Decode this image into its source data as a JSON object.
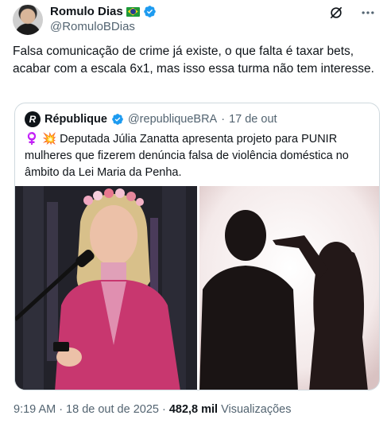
{
  "author": {
    "display_name": "Romulo Dias",
    "handle": "@RomuloBDias",
    "flag_icon": "brazil-flag-icon",
    "verified_icon": "verified-badge-icon"
  },
  "header_actions": {
    "grok_icon": "grok-icon",
    "more_icon": "more-options-icon"
  },
  "tweet": {
    "text": "Falsa comunicação de crime já existe, o que falta é taxar bets, acabar com a escala 6x1, mas isso essa turma não tem interesse."
  },
  "quote": {
    "avatar_letter": "R",
    "name": "République",
    "handle": "@republiqueBRA",
    "separator": "·",
    "time": "17 de out",
    "text": "♀️ 💥 Deputada Júlia Zanatta apresenta projeto para PUNIR mulheres que fizerem denúncia falsa de violência doméstica no âmbito da Lei Maria da Penha."
  },
  "footer": {
    "time": "9:19 AM",
    "separator": "·",
    "date": "18 de out de 2025",
    "separator2": "·",
    "views_count": "482,8 mil",
    "views_label": "Visualizações"
  },
  "colors": {
    "text": "#0f1419",
    "secondary": "#536471",
    "verified_blue": "#1d9bf0",
    "border": "#cfd9de",
    "jacket_pink": "#c8376f"
  }
}
